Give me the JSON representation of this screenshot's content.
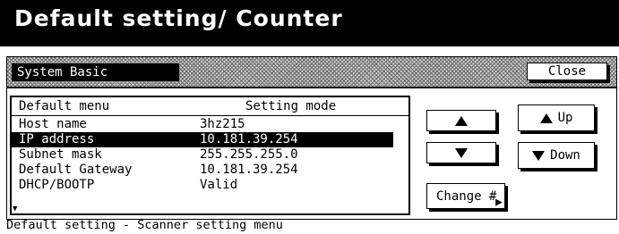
{
  "window": {
    "title": "Default setting/ Counter"
  },
  "tab": {
    "label": "System Basic"
  },
  "close_label": "Close",
  "list": {
    "headers": {
      "menu": "Default menu",
      "mode": "Setting mode"
    },
    "rows": [
      {
        "menu": "Host name",
        "value": "3hz215"
      },
      {
        "menu": "IP address",
        "value": "10.181.39.254"
      },
      {
        "menu": "Subnet mask",
        "value": "255.255.255.0"
      },
      {
        "menu": "Default Gateway",
        "value": "10.181.39.254"
      },
      {
        "menu": "DHCP/BOOTP",
        "value": "Valid"
      }
    ],
    "selected_index": 1
  },
  "buttons": {
    "scroll_up_icon": "triangle-up",
    "scroll_down_icon": "triangle-down",
    "up_label": "Up",
    "down_label": "Down",
    "change_label": "Change #"
  },
  "status_bar": {
    "text": "Default setting - Scanner setting menu"
  }
}
